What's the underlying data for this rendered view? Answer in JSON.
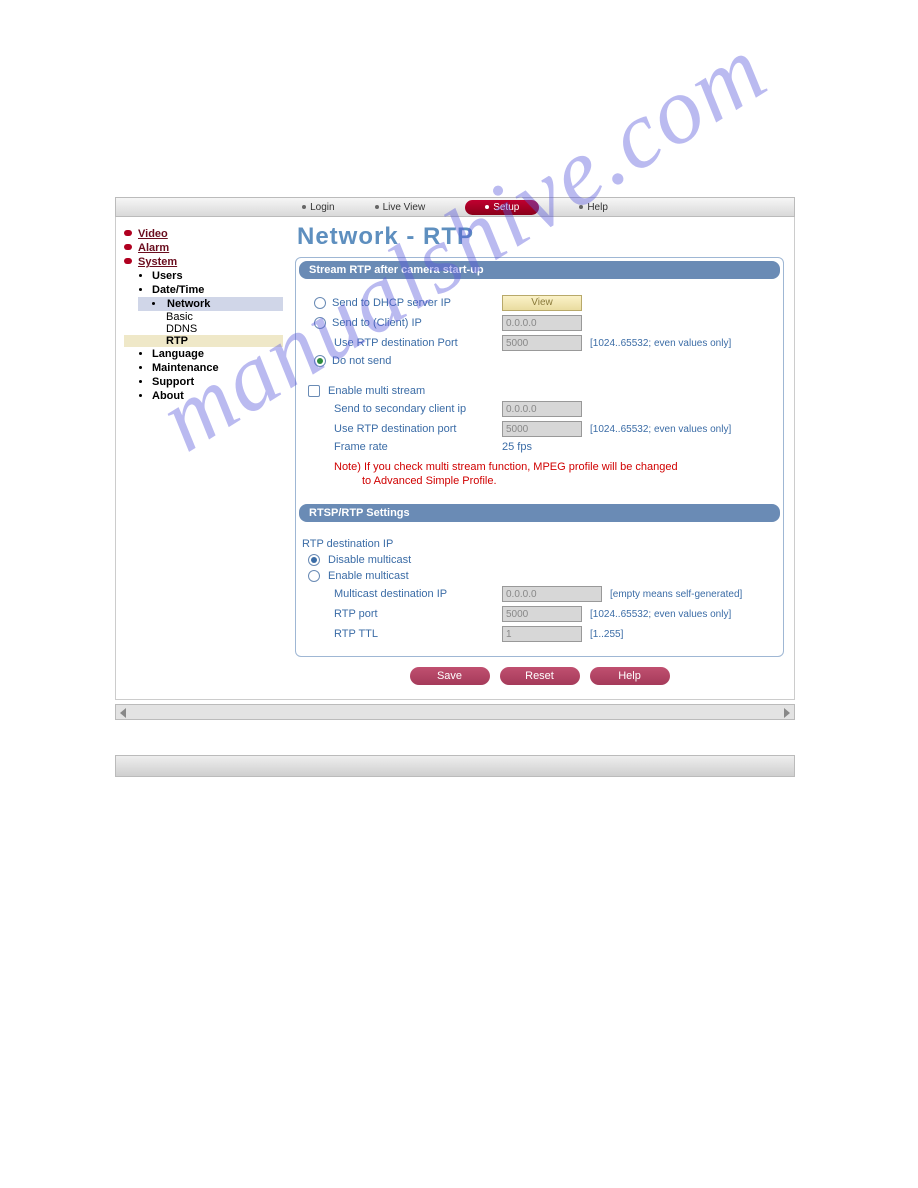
{
  "watermark": "manualshive.com",
  "topnav": {
    "login": "Login",
    "liveview": "Live View",
    "setup": "Setup",
    "help": "Help"
  },
  "sidebar": {
    "video": "Video",
    "alarm": "Alarm",
    "system": "System",
    "system_children": {
      "users": "Users",
      "datetime": "Date/Time",
      "network": "Network",
      "network_children": {
        "basic": "Basic",
        "ddns": "DDNS",
        "rtp": "RTP"
      },
      "language": "Language",
      "maintenance": "Maintenance",
      "support": "Support",
      "about": "About"
    }
  },
  "page": {
    "title": "Network - RTP"
  },
  "section1": {
    "header": "Stream RTP after camera start-up",
    "opt_dhcp": "Send to DHCP server IP",
    "view_btn": "View",
    "opt_client": "Send to (Client) IP",
    "client_ip": "0.0.0.0",
    "use_port": "Use RTP destination Port",
    "port_val": "5000",
    "port_hint": "[1024..65532; even values only]",
    "opt_nosend": "Do not send",
    "chk_multi": "Enable multi stream",
    "sec_client": "Send to secondary client ip",
    "sec_ip": "0.0.0.0",
    "sec_port_lbl": "Use RTP destination port",
    "sec_port_val": "5000",
    "sec_port_hint": "[1024..65532; even values only]",
    "frame_lbl": "Frame rate",
    "frame_val": "25 fps",
    "note1": "Note) If you check multi stream function, MPEG profile will be changed",
    "note2": "to Advanced Simple Profile."
  },
  "section2": {
    "header": "RTSP/RTP Settings",
    "dest_ip": "RTP destination IP",
    "disable": "Disable multicast",
    "enable": "Enable multicast",
    "mc_ip_lbl": "Multicast destination IP",
    "mc_ip_val": "0.0.0.0",
    "mc_ip_hint": "[empty means self-generated]",
    "rtp_port_lbl": "RTP port",
    "rtp_port_val": "5000",
    "rtp_port_hint": "[1024..65532; even values only]",
    "rtp_ttl_lbl": "RTP TTL",
    "rtp_ttl_val": "1",
    "rtp_ttl_hint": "[1..255]"
  },
  "actions": {
    "save": "Save",
    "reset": "Reset",
    "help": "Help"
  }
}
